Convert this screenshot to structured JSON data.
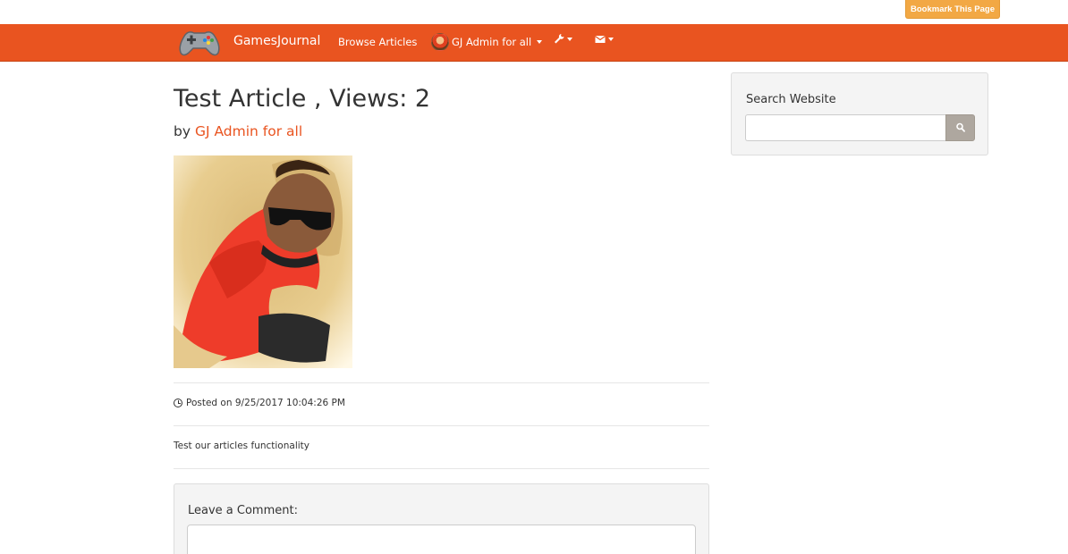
{
  "top": {
    "bookmark_label": "Bookmark This Page"
  },
  "navbar": {
    "brand": "GamesJournal",
    "browse_label": "Browse Articles",
    "user_label": "GJ Admin for all",
    "tools_icon": "wrench-icon",
    "messages_icon": "envelope-icon",
    "color": "#e95420"
  },
  "article": {
    "title": "Test Article , Views: 2",
    "by_prefix": "by ",
    "author": "GJ Admin for all",
    "posted": "Posted on 9/25/2017 10:04:26 PM",
    "body": "Test our articles functionality"
  },
  "comments": {
    "label": "Leave a Comment:",
    "value": ""
  },
  "sidebar": {
    "search_label": "Search Website",
    "search_value": "",
    "search_icon": "search-icon"
  },
  "colors": {
    "accent": "#e95420",
    "bookmark": "#f2a844",
    "search_button": "#aea79f"
  }
}
